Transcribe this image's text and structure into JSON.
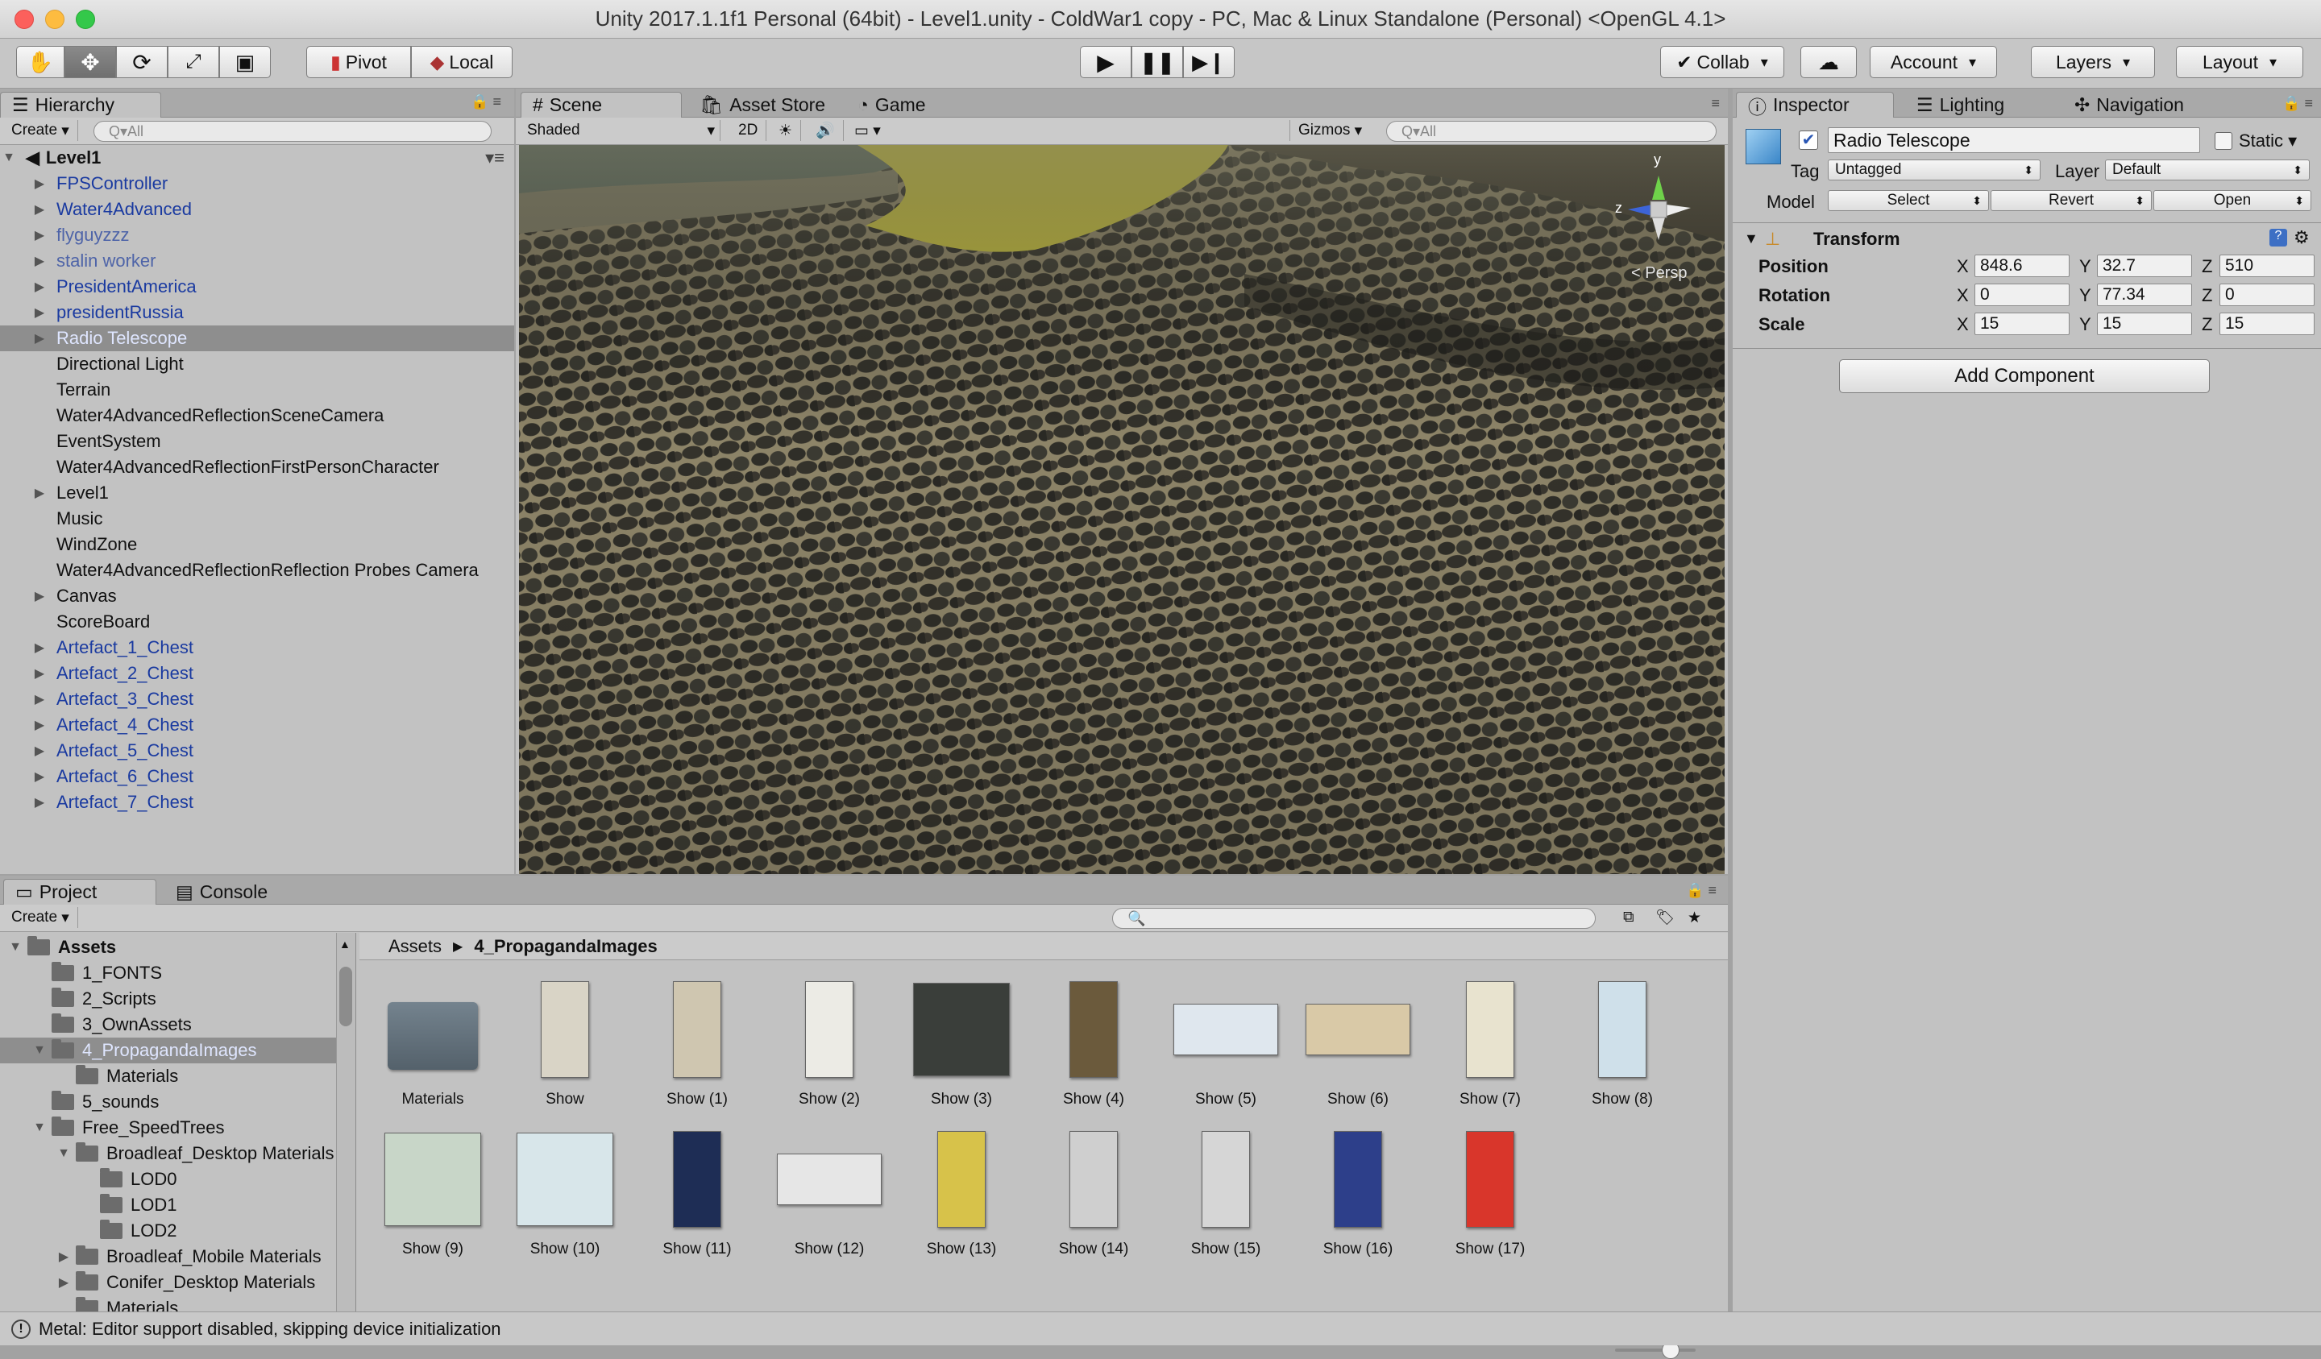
{
  "window": {
    "title": "Unity 2017.1.1f1 Personal (64bit) - Level1.unity - ColdWar1 copy - PC, Mac & Linux Standalone (Personal) <OpenGL 4.1>"
  },
  "toolbar": {
    "pivot": "Pivot",
    "local": "Local",
    "collab": "Collab",
    "account": "Account",
    "layers": "Layers",
    "layout": "Layout"
  },
  "hierarchy": {
    "tab": "Hierarchy",
    "create": "Create",
    "search_placeholder": "Q▾All",
    "root": "Level1",
    "items": [
      {
        "label": "FPSController",
        "expand": true,
        "style": "blue"
      },
      {
        "label": "Water4Advanced",
        "expand": true,
        "style": "blue"
      },
      {
        "label": "flyguyzzz",
        "expand": true,
        "style": "dimblue"
      },
      {
        "label": "stalin worker",
        "expand": true,
        "style": "dimblue"
      },
      {
        "label": "PresidentAmerica",
        "expand": true,
        "style": "blue"
      },
      {
        "label": "presidentRussia",
        "expand": true,
        "style": "blue"
      },
      {
        "label": "Radio Telescope",
        "expand": true,
        "style": "sel"
      },
      {
        "label": "Directional Light",
        "expand": false,
        "style": ""
      },
      {
        "label": "Terrain",
        "expand": false,
        "style": ""
      },
      {
        "label": "Water4AdvancedReflectionSceneCamera",
        "expand": false,
        "style": ""
      },
      {
        "label": "EventSystem",
        "expand": false,
        "style": ""
      },
      {
        "label": "Water4AdvancedReflectionFirstPersonCharacter",
        "expand": false,
        "style": ""
      },
      {
        "label": "Level1",
        "expand": true,
        "style": ""
      },
      {
        "label": "Music",
        "expand": false,
        "style": ""
      },
      {
        "label": "WindZone",
        "expand": false,
        "style": ""
      },
      {
        "label": "Water4AdvancedReflectionReflection Probes Camera",
        "expand": false,
        "style": ""
      },
      {
        "label": "Canvas",
        "expand": true,
        "style": ""
      },
      {
        "label": "ScoreBoard",
        "expand": false,
        "style": ""
      },
      {
        "label": "Artefact_1_Chest",
        "expand": true,
        "style": "blue"
      },
      {
        "label": "Artefact_2_Chest",
        "expand": true,
        "style": "blue"
      },
      {
        "label": "Artefact_3_Chest",
        "expand": true,
        "style": "blue"
      },
      {
        "label": "Artefact_4_Chest",
        "expand": true,
        "style": "blue"
      },
      {
        "label": "Artefact_5_Chest",
        "expand": true,
        "style": "blue"
      },
      {
        "label": "Artefact_6_Chest",
        "expand": true,
        "style": "blue"
      },
      {
        "label": "Artefact_7_Chest",
        "expand": true,
        "style": "blue"
      }
    ]
  },
  "scene": {
    "tabs": [
      "Scene",
      "Asset Store",
      "Game"
    ],
    "shading": "Shaded",
    "mode_2d": "2D",
    "gizmos": "Gizmos",
    "search_placeholder": "Q▾All",
    "persp": "< Persp",
    "axis_y": "y",
    "axis_z": "z"
  },
  "inspector": {
    "tabs": [
      "Inspector",
      "Lighting",
      "Navigation"
    ],
    "object_name": "Radio Telescope",
    "static_label": "Static",
    "tag_label": "Tag",
    "tag_value": "Untagged",
    "layer_label": "Layer",
    "layer_value": "Default",
    "model_label": "Model",
    "model_select": "Select",
    "model_revert": "Revert",
    "model_open": "Open",
    "transform": "Transform",
    "position": {
      "label": "Position",
      "x": "848.6",
      "y": "32.7",
      "z": "510"
    },
    "rotation": {
      "label": "Rotation",
      "x": "0",
      "y": "77.34",
      "z": "0"
    },
    "scale": {
      "label": "Scale",
      "x": "15",
      "y": "15",
      "z": "15"
    },
    "x": "X",
    "y": "Y",
    "z": "Z",
    "add_component": "Add Component"
  },
  "project": {
    "tabs": [
      "Project",
      "Console"
    ],
    "create": "Create",
    "tree": [
      {
        "label": "Assets",
        "depth": 0,
        "arrow": "▼",
        "bold": true
      },
      {
        "label": "1_FONTS",
        "depth": 1,
        "arrow": ""
      },
      {
        "label": "2_Scripts",
        "depth": 1,
        "arrow": ""
      },
      {
        "label": "3_OwnAssets",
        "depth": 1,
        "arrow": ""
      },
      {
        "label": "4_PropagandaImages",
        "depth": 1,
        "arrow": "▼",
        "selected": true
      },
      {
        "label": "Materials",
        "depth": 2,
        "arrow": ""
      },
      {
        "label": "5_sounds",
        "depth": 1,
        "arrow": ""
      },
      {
        "label": "Free_SpeedTrees",
        "depth": 1,
        "arrow": "▼"
      },
      {
        "label": "Broadleaf_Desktop Materials",
        "depth": 2,
        "arrow": "▼"
      },
      {
        "label": "LOD0",
        "depth": 3,
        "arrow": ""
      },
      {
        "label": "LOD1",
        "depth": 3,
        "arrow": ""
      },
      {
        "label": "LOD2",
        "depth": 3,
        "arrow": ""
      },
      {
        "label": "Broadleaf_Mobile Materials",
        "depth": 2,
        "arrow": "▶"
      },
      {
        "label": "Conifer_Desktop Materials",
        "depth": 2,
        "arrow": "▶"
      },
      {
        "label": "Materials",
        "depth": 2,
        "arrow": ""
      }
    ],
    "breadcrumb": [
      "Assets",
      "4_PropagandaImages"
    ],
    "assets": [
      {
        "label": "Materials",
        "kind": "folder",
        "color": "#5f6b75"
      },
      {
        "label": "Show",
        "kind": "tall",
        "color": "#d9d4c6"
      },
      {
        "label": "Show (1)",
        "kind": "tall",
        "color": "#cfc6b0"
      },
      {
        "label": "Show (2)",
        "kind": "tall",
        "color": "#ecebe5"
      },
      {
        "label": "Show (3)",
        "kind": "square",
        "color": "#3a3e3a"
      },
      {
        "label": "Show (4)",
        "kind": "tall",
        "color": "#6b5a3c"
      },
      {
        "label": "Show (5)",
        "kind": "wide",
        "color": "#dfe7ee"
      },
      {
        "label": "Show (6)",
        "kind": "wide",
        "color": "#d9c9a7"
      },
      {
        "label": "Show (7)",
        "kind": "tall",
        "color": "#e8e3cf"
      },
      {
        "label": "Show (8)",
        "kind": "tall",
        "color": "#cfe0ea"
      },
      {
        "label": "Show (9)",
        "kind": "square",
        "color": "#c8d6c8"
      },
      {
        "label": "Show (10)",
        "kind": "square",
        "color": "#d8e6ea"
      },
      {
        "label": "Show (11)",
        "kind": "tall",
        "color": "#1e2d55"
      },
      {
        "label": "Show (12)",
        "kind": "wide",
        "color": "#e6e6e6"
      },
      {
        "label": "Show (13)",
        "kind": "tall",
        "color": "#d7c24a"
      },
      {
        "label": "Show (14)",
        "kind": "tall",
        "color": "#cfcfcf"
      },
      {
        "label": "Show (15)",
        "kind": "tall",
        "color": "#d6d6d6"
      },
      {
        "label": "Show (16)",
        "kind": "tall",
        "color": "#2d3f8a"
      },
      {
        "label": "Show (17)",
        "kind": "tall",
        "color": "#d9362b"
      }
    ]
  },
  "status": {
    "message": "Metal: Editor support disabled, skipping device initialization"
  },
  "colors": {
    "close": "#fc605c",
    "min": "#fdbc40",
    "max": "#34c84a",
    "selected_row": "#8e8e8e",
    "link_blue": "#1a3aa0"
  }
}
